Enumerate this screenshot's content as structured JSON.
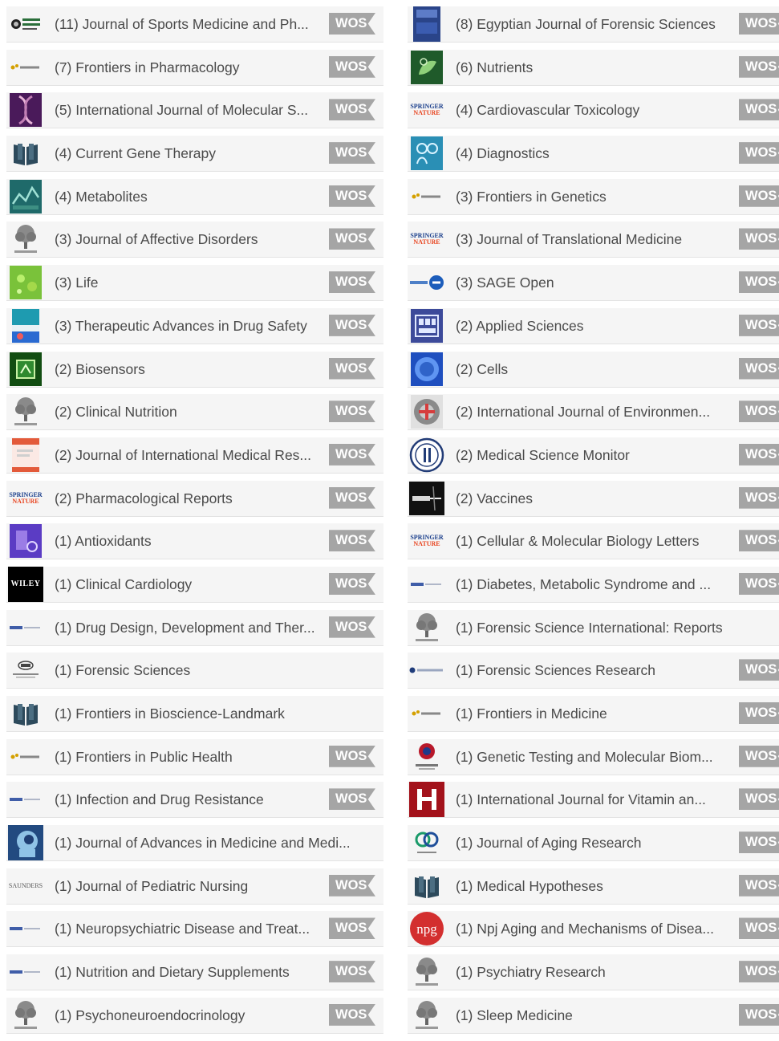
{
  "badge_label": "WOS",
  "colors": {
    "row_bg": "#f5f5f5",
    "badge_bg": "#a5a5a5",
    "text": "#4a4a4a"
  },
  "left": [
    {
      "title": "(11) Journal of Sports Medicine and Ph...",
      "wos": true,
      "logo": "minerva-logo"
    },
    {
      "title": "(7) Frontiers in Pharmacology",
      "wos": true,
      "logo": "frontiers-logo"
    },
    {
      "title": "(5) International Journal of Molecular S...",
      "wos": true,
      "logo": "dna-cover"
    },
    {
      "title": "(4) Current Gene Therapy",
      "wos": true,
      "logo": "book-icon"
    },
    {
      "title": "(4) Metabolites",
      "wos": true,
      "logo": "metabolites-cover"
    },
    {
      "title": "(3) Journal of Affective Disorders",
      "wos": true,
      "logo": "elsevier-tree"
    },
    {
      "title": "(3) Life",
      "wos": true,
      "logo": "life-cover"
    },
    {
      "title": "(3) Therapeutic Advances in Drug Safety",
      "wos": true,
      "logo": "sage-journal-cover"
    },
    {
      "title": "(2) Biosensors",
      "wos": true,
      "logo": "biosensors-cover"
    },
    {
      "title": "(2) Clinical Nutrition",
      "wos": true,
      "logo": "elsevier-tree"
    },
    {
      "title": "(2) Journal of International Medical Res...",
      "wos": true,
      "logo": "jimr-cover"
    },
    {
      "title": "(2) Pharmacological Reports",
      "wos": true,
      "logo": "springer-nature-logo"
    },
    {
      "title": "(1) Antioxidants",
      "wos": true,
      "logo": "antioxidants-cover"
    },
    {
      "title": "(1) Clinical Cardiology",
      "wos": true,
      "logo": "wiley-logo"
    },
    {
      "title": "(1) Drug Design, Development and Ther...",
      "wos": true,
      "logo": "dovepress-logo"
    },
    {
      "title": "(1) Forensic Sciences",
      "wos": false,
      "logo": "mdpi-logo"
    },
    {
      "title": "(1) Frontiers in Bioscience-Landmark",
      "wos": false,
      "logo": "book-icon"
    },
    {
      "title": "(1) Frontiers in Public Health",
      "wos": true,
      "logo": "frontiers-logo"
    },
    {
      "title": "(1) Infection and Drug Resistance",
      "wos": true,
      "logo": "dovepress-logo"
    },
    {
      "title": "(1) Journal of Advances in Medicine and Medi...",
      "wos": false,
      "logo": "head-cover"
    },
    {
      "title": "(1) Journal of Pediatric Nursing",
      "wos": true,
      "logo": "saunders-logo"
    },
    {
      "title": "(1) Neuropsychiatric Disease and Treat...",
      "wos": true,
      "logo": "dovepress-logo"
    },
    {
      "title": "(1) Nutrition and Dietary Supplements",
      "wos": true,
      "logo": "dovepress-logo"
    },
    {
      "title": "(1) Psychoneuroendocrinology",
      "wos": true,
      "logo": "elsevier-tree"
    }
  ],
  "right": [
    {
      "title": "(8) Egyptian Journal of Forensic Sciences",
      "wos": true,
      "logo": "ejfs-cover"
    },
    {
      "title": "(6) Nutrients",
      "wos": true,
      "logo": "nutrients-cover"
    },
    {
      "title": "(4) Cardiovascular Toxicology",
      "wos": true,
      "logo": "springer-nature-logo"
    },
    {
      "title": "(4) Diagnostics",
      "wos": true,
      "logo": "diagnostics-cover"
    },
    {
      "title": "(3) Frontiers in Genetics",
      "wos": true,
      "logo": "frontiers-logo"
    },
    {
      "title": "(3) Journal of Translational Medicine",
      "wos": true,
      "logo": "springer-nature-logo"
    },
    {
      "title": "(3) SAGE Open",
      "wos": true,
      "logo": "sage-open-logo"
    },
    {
      "title": "(2) Applied Sciences",
      "wos": true,
      "logo": "applied-sciences-cover"
    },
    {
      "title": "(2) Cells",
      "wos": true,
      "logo": "cells-cover"
    },
    {
      "title": "(2) International Journal of Environmen...",
      "wos": true,
      "logo": "ijerph-cover"
    },
    {
      "title": "(2) Medical Science Monitor",
      "wos": true,
      "logo": "msm-logo"
    },
    {
      "title": "(2) Vaccines",
      "wos": true,
      "logo": "vaccines-cover"
    },
    {
      "title": "(1) Cellular & Molecular Biology Letters",
      "wos": true,
      "logo": "springer-nature-logo"
    },
    {
      "title": "(1) Diabetes, Metabolic Syndrome and ...",
      "wos": true,
      "logo": "dovepress-logo"
    },
    {
      "title": "(1) Forensic Science International: Reports",
      "wos": false,
      "logo": "elsevier-tree"
    },
    {
      "title": "(1) Forensic Sciences Research",
      "wos": true,
      "logo": "fsr-logo"
    },
    {
      "title": "(1) Frontiers in Medicine",
      "wos": true,
      "logo": "frontiers-logo"
    },
    {
      "title": "(1) Genetic Testing and Molecular Biom...",
      "wos": true,
      "logo": "genetic-testing-cover"
    },
    {
      "title": "(1) International Journal for Vitamin an...",
      "wos": true,
      "logo": "hogrefe-logo"
    },
    {
      "title": "(1) Journal of Aging Research",
      "wos": true,
      "logo": "hindawi-logo"
    },
    {
      "title": "(1) Medical Hypotheses",
      "wos": true,
      "logo": "book-icon"
    },
    {
      "title": "(1) Npj Aging and Mechanisms of Disea...",
      "wos": true,
      "logo": "npg-logo"
    },
    {
      "title": "(1) Psychiatry Research",
      "wos": true,
      "logo": "elsevier-tree"
    },
    {
      "title": "(1) Sleep Medicine",
      "wos": true,
      "logo": "elsevier-tree"
    }
  ]
}
